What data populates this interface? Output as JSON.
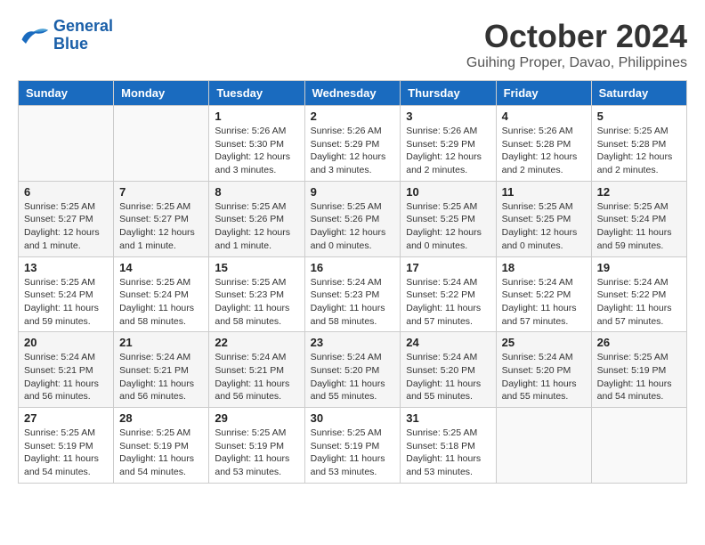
{
  "logo": {
    "line1": "General",
    "line2": "Blue"
  },
  "title": "October 2024",
  "subtitle": "Guihing Proper, Davao, Philippines",
  "weekdays": [
    "Sunday",
    "Monday",
    "Tuesday",
    "Wednesday",
    "Thursday",
    "Friday",
    "Saturday"
  ],
  "weeks": [
    [
      {
        "day": "",
        "detail": ""
      },
      {
        "day": "",
        "detail": ""
      },
      {
        "day": "1",
        "detail": "Sunrise: 5:26 AM\nSunset: 5:30 PM\nDaylight: 12 hours and 3 minutes."
      },
      {
        "day": "2",
        "detail": "Sunrise: 5:26 AM\nSunset: 5:29 PM\nDaylight: 12 hours and 3 minutes."
      },
      {
        "day": "3",
        "detail": "Sunrise: 5:26 AM\nSunset: 5:29 PM\nDaylight: 12 hours and 2 minutes."
      },
      {
        "day": "4",
        "detail": "Sunrise: 5:26 AM\nSunset: 5:28 PM\nDaylight: 12 hours and 2 minutes."
      },
      {
        "day": "5",
        "detail": "Sunrise: 5:25 AM\nSunset: 5:28 PM\nDaylight: 12 hours and 2 minutes."
      }
    ],
    [
      {
        "day": "6",
        "detail": "Sunrise: 5:25 AM\nSunset: 5:27 PM\nDaylight: 12 hours and 1 minute."
      },
      {
        "day": "7",
        "detail": "Sunrise: 5:25 AM\nSunset: 5:27 PM\nDaylight: 12 hours and 1 minute."
      },
      {
        "day": "8",
        "detail": "Sunrise: 5:25 AM\nSunset: 5:26 PM\nDaylight: 12 hours and 1 minute."
      },
      {
        "day": "9",
        "detail": "Sunrise: 5:25 AM\nSunset: 5:26 PM\nDaylight: 12 hours and 0 minutes."
      },
      {
        "day": "10",
        "detail": "Sunrise: 5:25 AM\nSunset: 5:25 PM\nDaylight: 12 hours and 0 minutes."
      },
      {
        "day": "11",
        "detail": "Sunrise: 5:25 AM\nSunset: 5:25 PM\nDaylight: 12 hours and 0 minutes."
      },
      {
        "day": "12",
        "detail": "Sunrise: 5:25 AM\nSunset: 5:24 PM\nDaylight: 11 hours and 59 minutes."
      }
    ],
    [
      {
        "day": "13",
        "detail": "Sunrise: 5:25 AM\nSunset: 5:24 PM\nDaylight: 11 hours and 59 minutes."
      },
      {
        "day": "14",
        "detail": "Sunrise: 5:25 AM\nSunset: 5:24 PM\nDaylight: 11 hours and 58 minutes."
      },
      {
        "day": "15",
        "detail": "Sunrise: 5:25 AM\nSunset: 5:23 PM\nDaylight: 11 hours and 58 minutes."
      },
      {
        "day": "16",
        "detail": "Sunrise: 5:24 AM\nSunset: 5:23 PM\nDaylight: 11 hours and 58 minutes."
      },
      {
        "day": "17",
        "detail": "Sunrise: 5:24 AM\nSunset: 5:22 PM\nDaylight: 11 hours and 57 minutes."
      },
      {
        "day": "18",
        "detail": "Sunrise: 5:24 AM\nSunset: 5:22 PM\nDaylight: 11 hours and 57 minutes."
      },
      {
        "day": "19",
        "detail": "Sunrise: 5:24 AM\nSunset: 5:22 PM\nDaylight: 11 hours and 57 minutes."
      }
    ],
    [
      {
        "day": "20",
        "detail": "Sunrise: 5:24 AM\nSunset: 5:21 PM\nDaylight: 11 hours and 56 minutes."
      },
      {
        "day": "21",
        "detail": "Sunrise: 5:24 AM\nSunset: 5:21 PM\nDaylight: 11 hours and 56 minutes."
      },
      {
        "day": "22",
        "detail": "Sunrise: 5:24 AM\nSunset: 5:21 PM\nDaylight: 11 hours and 56 minutes."
      },
      {
        "day": "23",
        "detail": "Sunrise: 5:24 AM\nSunset: 5:20 PM\nDaylight: 11 hours and 55 minutes."
      },
      {
        "day": "24",
        "detail": "Sunrise: 5:24 AM\nSunset: 5:20 PM\nDaylight: 11 hours and 55 minutes."
      },
      {
        "day": "25",
        "detail": "Sunrise: 5:24 AM\nSunset: 5:20 PM\nDaylight: 11 hours and 55 minutes."
      },
      {
        "day": "26",
        "detail": "Sunrise: 5:25 AM\nSunset: 5:19 PM\nDaylight: 11 hours and 54 minutes."
      }
    ],
    [
      {
        "day": "27",
        "detail": "Sunrise: 5:25 AM\nSunset: 5:19 PM\nDaylight: 11 hours and 54 minutes."
      },
      {
        "day": "28",
        "detail": "Sunrise: 5:25 AM\nSunset: 5:19 PM\nDaylight: 11 hours and 54 minutes."
      },
      {
        "day": "29",
        "detail": "Sunrise: 5:25 AM\nSunset: 5:19 PM\nDaylight: 11 hours and 53 minutes."
      },
      {
        "day": "30",
        "detail": "Sunrise: 5:25 AM\nSunset: 5:19 PM\nDaylight: 11 hours and 53 minutes."
      },
      {
        "day": "31",
        "detail": "Sunrise: 5:25 AM\nSunset: 5:18 PM\nDaylight: 11 hours and 53 minutes."
      },
      {
        "day": "",
        "detail": ""
      },
      {
        "day": "",
        "detail": ""
      }
    ]
  ]
}
